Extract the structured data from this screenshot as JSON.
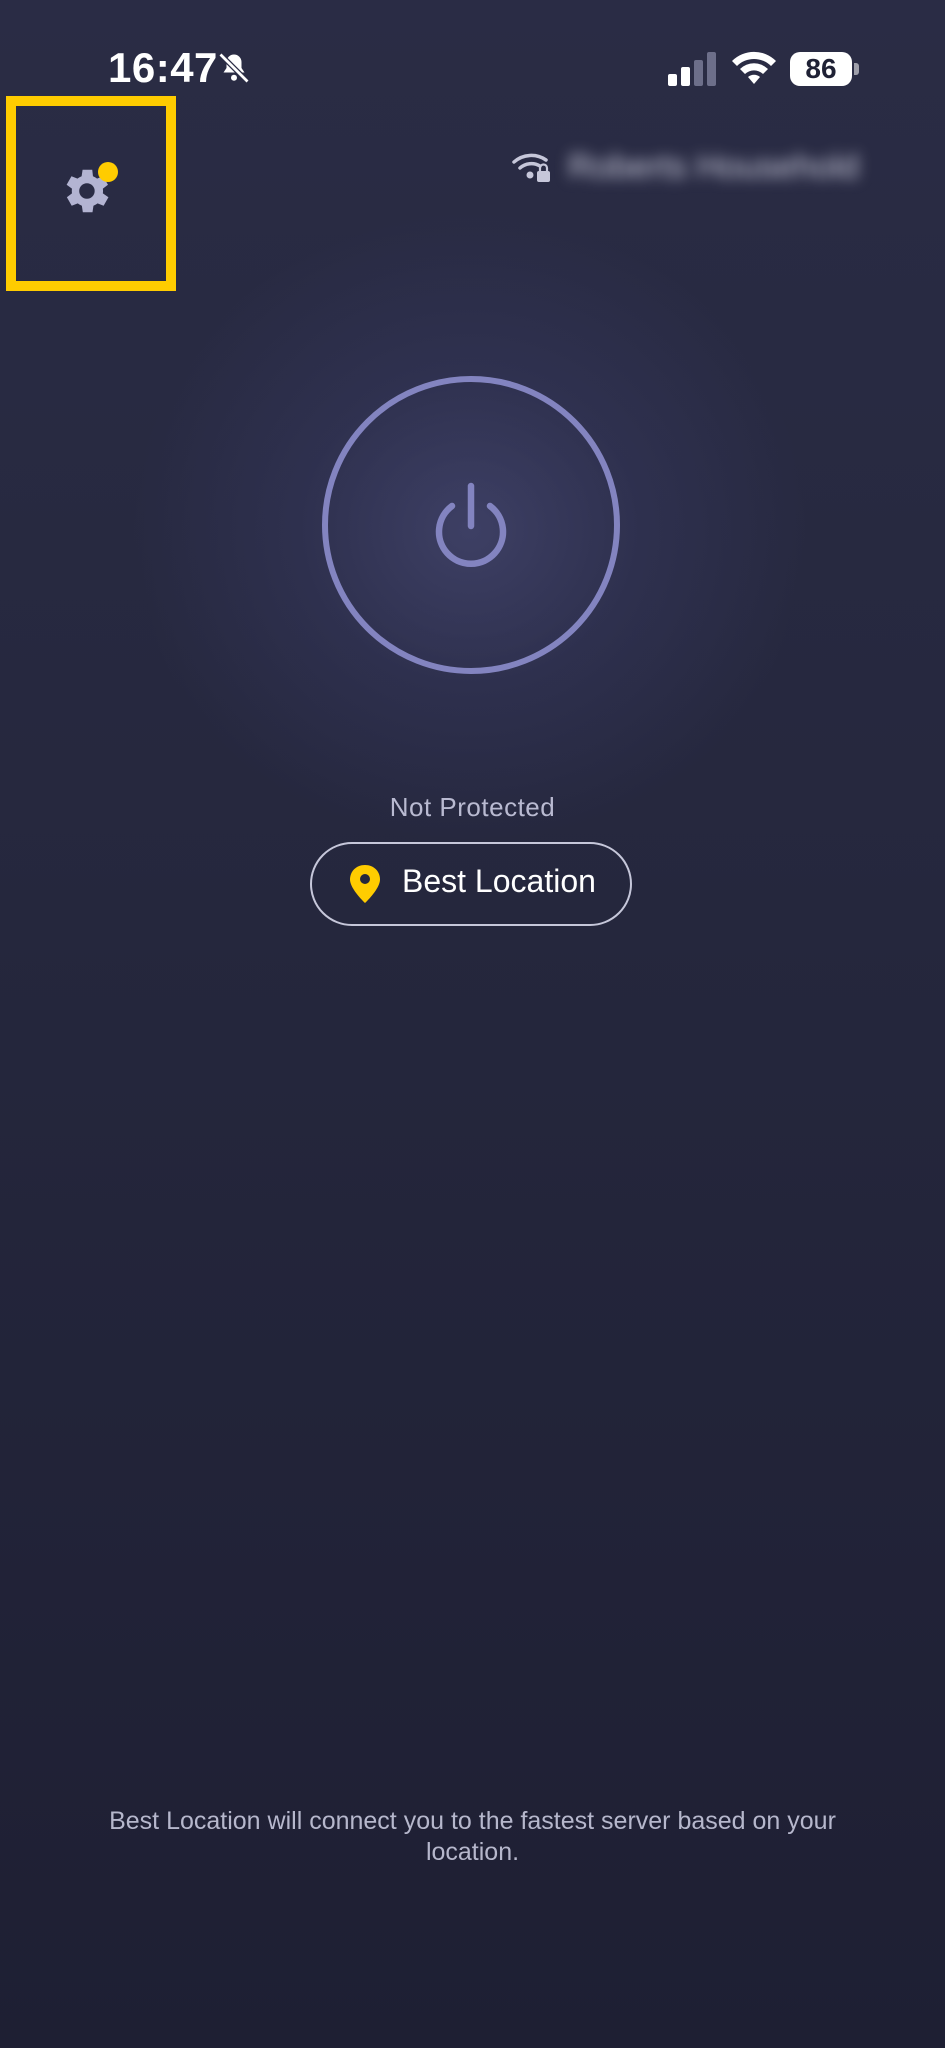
{
  "status_bar": {
    "time": "16:47",
    "battery": "86",
    "icons": [
      "bell-slash-icon",
      "cellular-signal-icon",
      "wifi-icon"
    ]
  },
  "header": {
    "settings_icon": "gear-icon",
    "has_notification": true,
    "network_icon": "wifi-lock-icon",
    "network_name": "Roberts Household"
  },
  "main": {
    "power_icon": "power-icon",
    "status": "Not Protected",
    "location_label": "Best Location",
    "location_icon": "location-pin-icon"
  },
  "footer": {
    "note": "Best Location will connect you to the fastest server based on your location."
  },
  "colors": {
    "accent": "#ffcc00",
    "ring": "#8384c0",
    "background": "#25273d",
    "muted_text": "#b9bad1"
  }
}
